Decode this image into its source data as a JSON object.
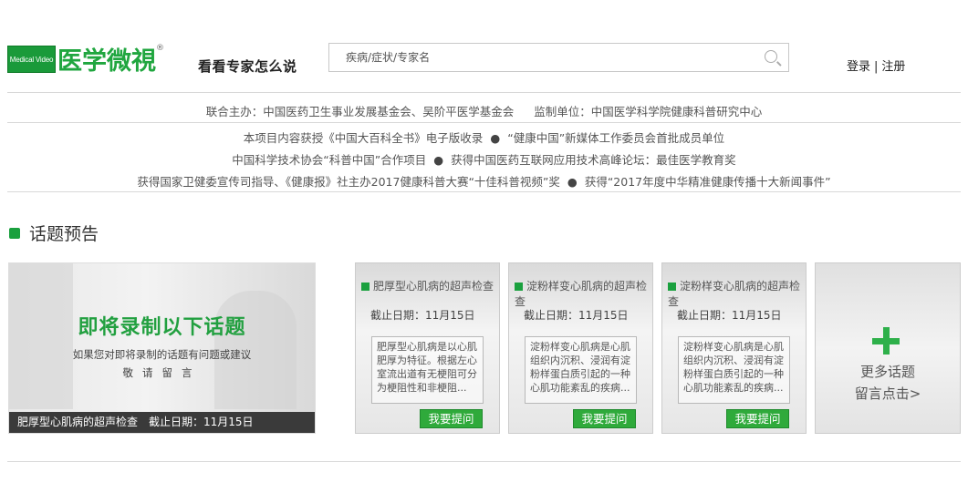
{
  "header": {
    "logo_en": "Medical Video",
    "logo_cn": "医学微視",
    "logo_reg": "®",
    "slogan": "看看专家怎么说",
    "search_placeholder": "疾病/症状/专家名",
    "login": "登录",
    "separator": "|",
    "register": "注册"
  },
  "info": {
    "organizers_label": "联合主办：",
    "organizers": "中国医药卫生事业发展基金会、吴阶平医学基金会",
    "supervisor_label": "监制单位：",
    "supervisor": "中国医学科学院健康科普研究中心",
    "dot": "●",
    "row1_left": "本项目内容获授《中国大百科全书》电子版收录",
    "row1_right": "“健康中国”新媒体工作委员会首批成员单位",
    "row2_left": "中国科学技术协会“科普中国”合作项目",
    "row2_right": "获得中国医药互联网应用技术高峰论坛：最佳医学教育奖",
    "row3_left": "获得国家卫健委宣传司指导、《健康报》社主办2017健康科普大赛“十佳科普视频”奖",
    "row3_right": "获得“2017年度中华精准健康传播十大新闻事件”"
  },
  "section": {
    "title": "话题预告"
  },
  "hero": {
    "title": "即将录制以下话题",
    "sub1": "如果您对即将录制的话题有问题或建议",
    "sub2": "敬请留言",
    "bar": "肥厚型心肌病的超声检查　截止日期：11月15日"
  },
  "cards": [
    {
      "title": "肥厚型心肌病的超声检查",
      "date": "截止日期：11月15日",
      "desc": "肥厚型心肌病是以心肌肥厚为特征。根据左心室流出道有无梗阻可分为梗阻性和非梗阻...",
      "button": "我要提问"
    },
    {
      "title": "淀粉样变心肌病的超声检查",
      "date": "截止日期：11月15日",
      "desc": "淀粉样变心肌病是心肌组织内沉积、浸润有淀粉样蛋白质引起的一种心肌功能紊乱的疾病...",
      "button": "我要提问"
    },
    {
      "title": "淀粉样变心肌病的超声检查",
      "date": "截止日期：11月15日",
      "desc": "淀粉样变心肌病是心肌组织内沉积、浸润有淀粉样蛋白质引起的一种心肌功能紊乱的疾病...",
      "button": "我要提问"
    }
  ],
  "more": {
    "line1": "更多话题",
    "line2": "留言点击>"
  },
  "colors": {
    "brand_green": "#1aa03e",
    "button_green": "#2faa3b"
  }
}
